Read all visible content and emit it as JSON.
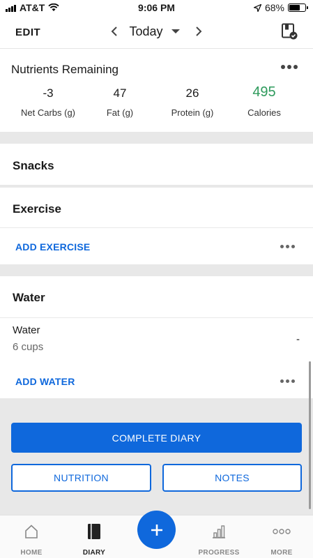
{
  "status_bar": {
    "carrier": "AT&T",
    "time": "9:06 PM",
    "battery": "68%",
    "battery_level": 0.68
  },
  "top_nav": {
    "edit_label": "EDIT",
    "date_label": "Today"
  },
  "nutrients": {
    "title": "Nutrients Remaining",
    "items": [
      {
        "value": "-3",
        "label": "Net Carbs (g)"
      },
      {
        "value": "47",
        "label": "Fat (g)"
      },
      {
        "value": "26",
        "label": "Protein (g)"
      },
      {
        "value": "495",
        "label": "Calories"
      }
    ],
    "calories_color": "#2e9a5c"
  },
  "snacks": {
    "title": "Snacks"
  },
  "exercise": {
    "title": "Exercise",
    "add_label": "ADD EXERCISE"
  },
  "water": {
    "title": "Water",
    "item_name": "Water",
    "item_amount": "6 cups",
    "item_value": "-",
    "add_label": "ADD WATER"
  },
  "actions": {
    "complete_label": "COMPLETE DIARY",
    "nutrition_label": "NUTRITION",
    "notes_label": "NOTES"
  },
  "tab_bar": {
    "home": "HOME",
    "diary": "DIARY",
    "progress": "PROGRESS",
    "more": "MORE"
  },
  "colors": {
    "accent": "#0f68dc",
    "section_gap": "#e8e8e8"
  }
}
